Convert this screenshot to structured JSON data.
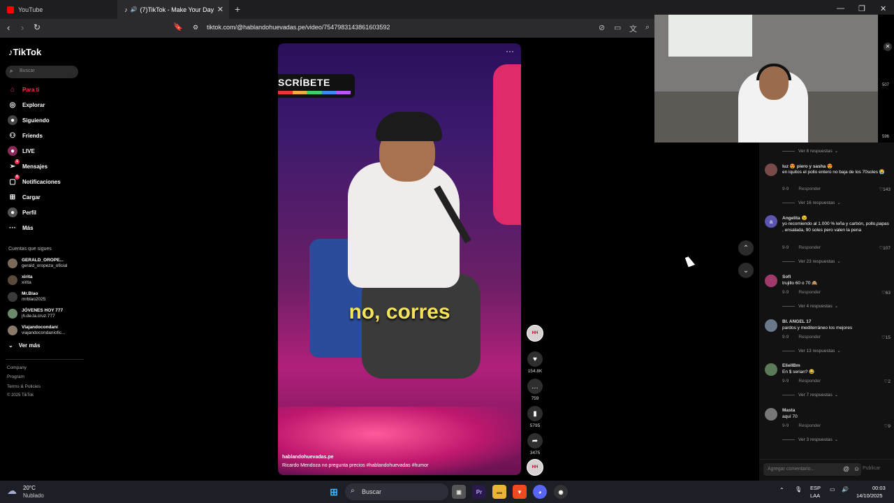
{
  "browser": {
    "tabs": [
      {
        "label": "YouTube",
        "color": "#ff0000"
      },
      {
        "label": "(7)TikTok - Make Your Day",
        "color": "#000000"
      }
    ],
    "url": "tiktok.com/@hablandohuevadas.pe/video/7547983143861603592"
  },
  "sidebar": {
    "logo": "TikTok",
    "search_placeholder": "Buscar",
    "nav": [
      {
        "label": "Para ti",
        "icon": "home-icon",
        "active": true
      },
      {
        "label": "Explorar",
        "icon": "compass-icon"
      },
      {
        "label": "Siguiendo",
        "icon": "following-icon"
      },
      {
        "label": "Friends",
        "icon": "friends-icon"
      },
      {
        "label": "LIVE",
        "icon": "live-icon"
      },
      {
        "label": "Mensajes",
        "icon": "messages-icon",
        "badge": "1"
      },
      {
        "label": "Notificaciones",
        "icon": "bell-icon",
        "badge": "6"
      },
      {
        "label": "Cargar",
        "icon": "upload-icon"
      },
      {
        "label": "Perfil",
        "icon": "profile-icon"
      },
      {
        "label": "Más",
        "icon": "more-icon"
      }
    ],
    "following_title": "Cuentas que sigues",
    "following": [
      {
        "name": "GERALD_OROPE...",
        "handle": "gerald_oropeza_oficial"
      },
      {
        "name": "xirita",
        "handle": "xirita"
      },
      {
        "name": "Mr.Blao",
        "handle": "mrblao2025"
      },
      {
        "name": "JÓVENES HOY 777",
        "handle": "jh.de.la.cruz.777"
      },
      {
        "name": "Viajandocondani",
        "handle": "viajandocondaniofic..."
      }
    ],
    "see_more": "Ver más",
    "footer": [
      "Company",
      "Program",
      "Terms & Policies",
      "© 2025 TikTok"
    ]
  },
  "video": {
    "overlay_text": "SCRÍBETE",
    "caption": "no, corres",
    "author": "hablandohuevadas.pe",
    "description": "Ricardo Mendoza no pregunta precios #hablandohuevadas #humor"
  },
  "actions": {
    "likes": "154.8K",
    "comments": "759",
    "saves": "5795",
    "shares": "3475"
  },
  "right_strip": [
    "507",
    "596"
  ],
  "comments": [
    {
      "type": "replies",
      "label": "Ver 8 respuestas"
    },
    {
      "type": "comment",
      "user": "luz 😍 piero y sasha 😍",
      "text": "en iquitos el pollo entero no baja de los 70soles 😭",
      "date": "9-9",
      "reply": "Responder",
      "likes": "143"
    },
    {
      "type": "replies",
      "label": "Ver 16 respuestas"
    },
    {
      "type": "comment",
      "user": "Angelita 😉",
      "text": "yo recomiendo al 1.000 % leña y carbón, pollo,papas , ensalada, 90 soles pero valen la pena",
      "date": "9-9",
      "reply": "Responder",
      "likes": "107",
      "avatar_letter": "a"
    },
    {
      "type": "replies",
      "label": "Ver 23 respuestas"
    },
    {
      "type": "comment",
      "user": "Sofi",
      "text": "trujillo 60 o 70 🙈",
      "date": "9-9",
      "reply": "Responder",
      "likes": "63"
    },
    {
      "type": "replies",
      "label": "Ver 4 respuestas"
    },
    {
      "type": "comment",
      "user": "BI. ANGEL 17",
      "text": "pardos y mediterráneo los mejores",
      "date": "9-9",
      "reply": "Responder",
      "likes": "15"
    },
    {
      "type": "replies",
      "label": "Ver 13 respuestas"
    },
    {
      "type": "comment",
      "user": "EliellBm",
      "text": "En $ serian? 😂",
      "date": "9-9",
      "reply": "Responder",
      "likes": "2"
    },
    {
      "type": "replies",
      "label": "Ver 7 respuestas"
    },
    {
      "type": "comment",
      "user": "Masta",
      "text": "aquí 70",
      "date": "9-9",
      "reply": "Responder",
      "likes": "9"
    },
    {
      "type": "replies",
      "label": "Ver 3 respuestas"
    }
  ],
  "comment_input": {
    "placeholder": "Agregar comentario...",
    "publish": "Publicar"
  },
  "taskbar": {
    "weather_temp": "20°C",
    "weather_desc": "Nublado",
    "search": "Buscar",
    "lang1": "ESP",
    "lang2": "LAA",
    "time": "00:03",
    "date": "14/10/2025"
  }
}
